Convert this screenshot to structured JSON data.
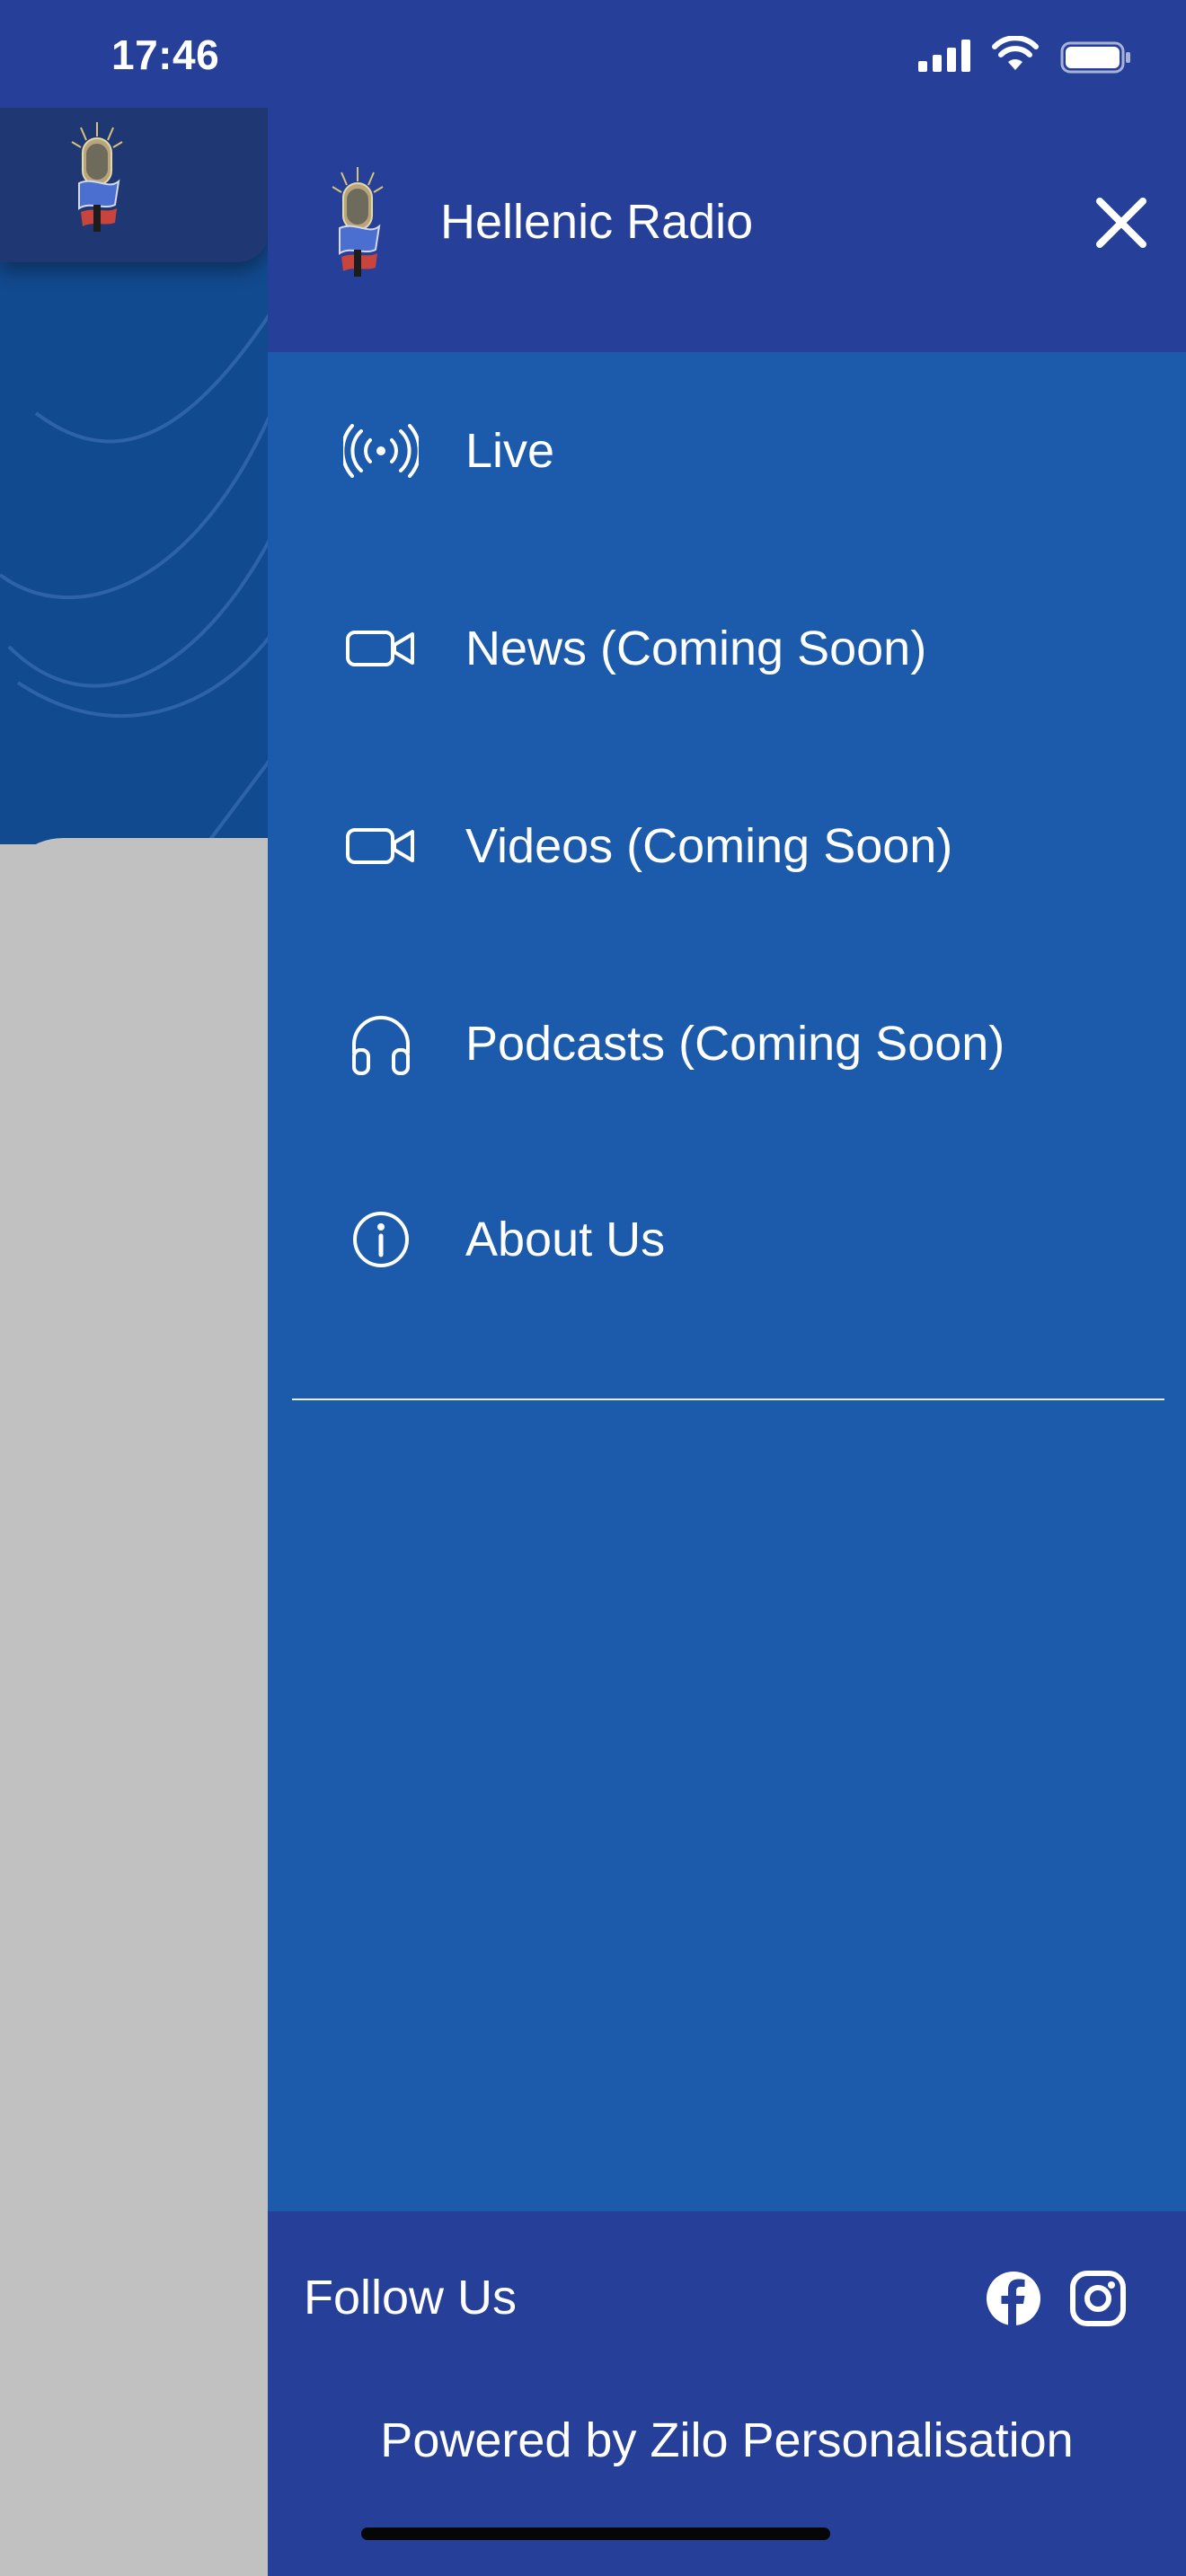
{
  "status_bar": {
    "time": "17:46"
  },
  "drawer": {
    "header": {
      "title": "Hellenic Radio",
      "logo_icon": "microphone-logo-icon",
      "close_icon": "close-icon"
    },
    "menu_items": [
      {
        "label": "Live",
        "icon": "broadcast-icon"
      },
      {
        "label": "News (Coming Soon)",
        "icon": "video-camera-icon"
      },
      {
        "label": "Videos (Coming Soon)",
        "icon": "video-camera-icon"
      },
      {
        "label": "Podcasts (Coming Soon)",
        "icon": "headphones-icon"
      },
      {
        "label": "About Us",
        "icon": "info-icon"
      }
    ],
    "footer": {
      "follow_label": "Follow Us",
      "social_icons": [
        "facebook-icon",
        "instagram-icon"
      ],
      "powered_by": "Powered by Zilo Personalisation"
    }
  },
  "colors": {
    "header_bg": "#263f99",
    "drawer_bg": "#1c5aab",
    "background_app": "#124a8f",
    "content_card": "#c1c1c1",
    "text": "#ffffff"
  }
}
